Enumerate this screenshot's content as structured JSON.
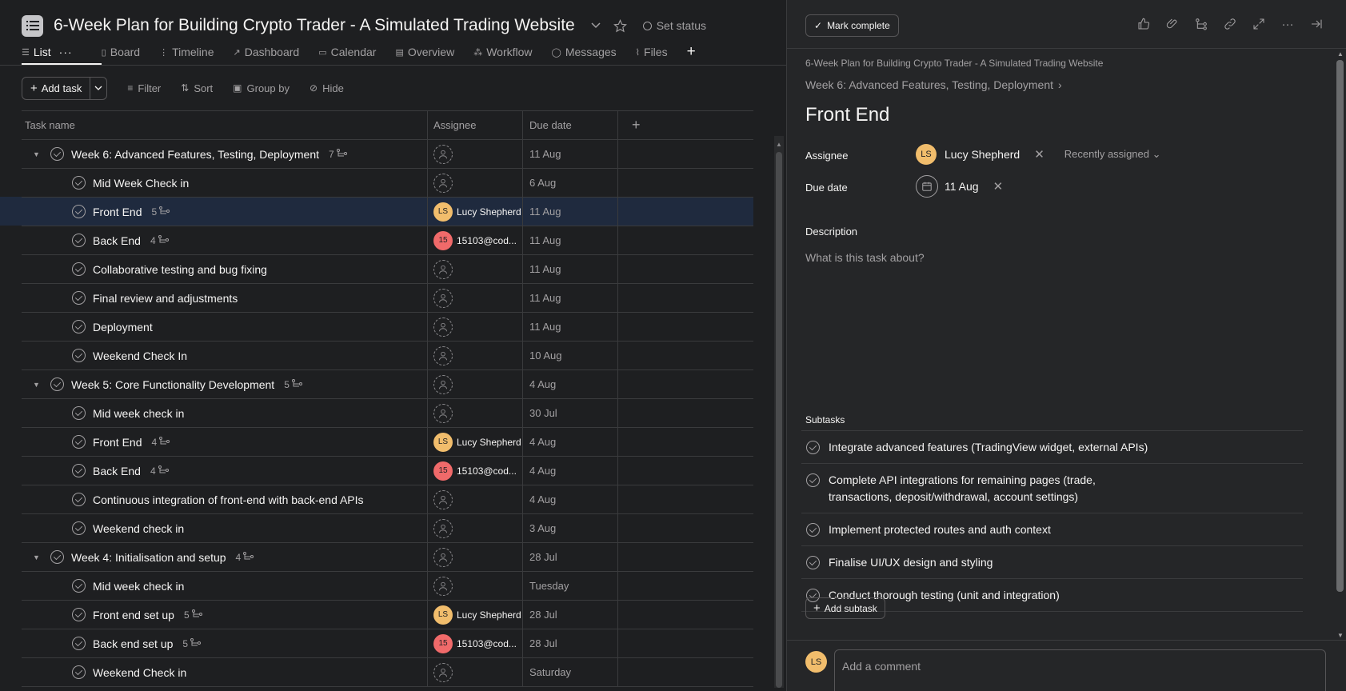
{
  "project": {
    "title": "6-Week Plan for Building Crypto Trader - A Simulated Trading Website",
    "set_status": "Set status"
  },
  "tabs": [
    {
      "label": "List"
    },
    {
      "label": "Board"
    },
    {
      "label": "Timeline"
    },
    {
      "label": "Dashboard"
    },
    {
      "label": "Calendar"
    },
    {
      "label": "Overview"
    },
    {
      "label": "Workflow"
    },
    {
      "label": "Messages"
    },
    {
      "label": "Files"
    }
  ],
  "toolbar": {
    "add_task": "Add task",
    "filter": "Filter",
    "sort": "Sort",
    "group_by": "Group by",
    "hide": "Hide"
  },
  "table": {
    "headers": {
      "name": "Task name",
      "assignee": "Assignee",
      "due": "Due date"
    },
    "rows": [
      {
        "type": "section",
        "name": "Week 6: Advanced Features, Testing, Deployment",
        "subtasks": "7",
        "assignee": "",
        "due": "11 Aug"
      },
      {
        "type": "task",
        "name": "Mid Week Check in",
        "subtasks": "",
        "assignee": "",
        "due": "6 Aug"
      },
      {
        "type": "task",
        "name": "Front End",
        "subtasks": "5",
        "assignee": "Lucy Shepherd",
        "initials": "LS",
        "due": "11 Aug",
        "selected": true
      },
      {
        "type": "task",
        "name": "Back End",
        "subtasks": "4",
        "assignee": "15103@cod...",
        "initials": "15",
        "due": "11 Aug"
      },
      {
        "type": "task",
        "name": "Collaborative testing and bug fixing",
        "subtasks": "",
        "assignee": "",
        "due": "11 Aug"
      },
      {
        "type": "task",
        "name": "Final review and adjustments",
        "subtasks": "",
        "assignee": "",
        "due": "11 Aug"
      },
      {
        "type": "task",
        "name": "Deployment",
        "subtasks": "",
        "assignee": "",
        "due": "11 Aug"
      },
      {
        "type": "task",
        "name": "Weekend Check In",
        "subtasks": "",
        "assignee": "",
        "due": "10 Aug"
      },
      {
        "type": "section",
        "name": "Week 5: Core Functionality Development",
        "subtasks": "5",
        "assignee": "",
        "due": "4 Aug"
      },
      {
        "type": "task",
        "name": "Mid week check in",
        "subtasks": "",
        "assignee": "",
        "due": "30 Jul"
      },
      {
        "type": "task",
        "name": "Front End",
        "subtasks": "4",
        "assignee": "Lucy Shepherd",
        "initials": "LS",
        "due": "4 Aug"
      },
      {
        "type": "task",
        "name": "Back End",
        "subtasks": "4",
        "assignee": "15103@cod...",
        "initials": "15",
        "due": "4 Aug"
      },
      {
        "type": "task",
        "name": "Continuous integration of front-end with back-end APIs",
        "subtasks": "",
        "assignee": "",
        "due": "4 Aug"
      },
      {
        "type": "task",
        "name": "Weekend check in",
        "subtasks": "",
        "assignee": "",
        "due": "3 Aug"
      },
      {
        "type": "section",
        "name": "Week 4: Initialisation and setup",
        "subtasks": "4",
        "assignee": "",
        "due": "28 Jul"
      },
      {
        "type": "task",
        "name": "Mid week check in",
        "subtasks": "",
        "assignee": "",
        "due": "Tuesday"
      },
      {
        "type": "task",
        "name": "Front end set up",
        "subtasks": "5",
        "assignee": "Lucy Shepherd",
        "initials": "LS",
        "due": "28 Jul"
      },
      {
        "type": "task",
        "name": "Back end set up",
        "subtasks": "5",
        "assignee": "15103@cod...",
        "initials": "15",
        "due": "28 Jul"
      },
      {
        "type": "task",
        "name": "Weekend Check in",
        "subtasks": "",
        "assignee": "",
        "due": "Saturday"
      }
    ]
  },
  "detail": {
    "mark_complete": "Mark complete",
    "breadcrumb_project": "6-Week Plan for Building Crypto Trader - A Simulated Trading Website",
    "breadcrumb_section": "Week 6: Advanced Features, Testing, Deployment",
    "title": "Front End",
    "assignee_label": "Assignee",
    "assignee_name": "Lucy Shepherd",
    "assignee_initials": "LS",
    "recently_assigned": "Recently assigned",
    "due_label": "Due date",
    "due_value": "11 Aug",
    "description_label": "Description",
    "description_placeholder": "What is this task about?",
    "subtasks_label": "Subtasks",
    "subtasks": [
      "Integrate advanced features (TradingView widget, external APIs)",
      "Complete API integrations for remaining pages (trade, transactions, deposit/withdrawal, account settings)",
      "Implement protected routes and auth context",
      "Finalise UI/UX design and styling",
      "Conduct thorough testing (unit and integration)"
    ],
    "add_subtask": "Add subtask",
    "comment_placeholder": "Add a comment",
    "comment_initials": "LS"
  },
  "colors": {
    "accent_ls": "#f1bd6c",
    "accent_15": "#f06a6a",
    "selected_row": "#1f2a3e"
  },
  "icons": [
    "list-icon",
    "star-icon",
    "chevron-down-icon",
    "like-icon",
    "attachment-icon",
    "subtask-icon",
    "link-icon",
    "expand-icon",
    "more-icon",
    "close-pane-icon",
    "calendar-icon"
  ]
}
